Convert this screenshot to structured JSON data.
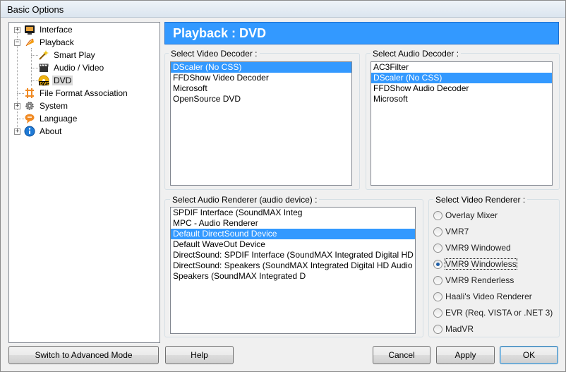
{
  "window": {
    "title": "Basic Options"
  },
  "tree": {
    "items": [
      {
        "label": "Interface",
        "icon": "monitor-icon"
      },
      {
        "label": "Playback",
        "icon": "play-icon"
      },
      {
        "label": "Smart Play",
        "icon": "magic-wand-icon"
      },
      {
        "label": "Audio / Video",
        "icon": "clapperboard-icon"
      },
      {
        "label": "DVD",
        "icon": "dvd-disc-icon"
      },
      {
        "label": "File Format Association",
        "icon": "file-association-icon"
      },
      {
        "label": "System",
        "icon": "gear-icon"
      },
      {
        "label": "Language",
        "icon": "speech-bubble-icon"
      },
      {
        "label": "About",
        "icon": "info-icon"
      }
    ],
    "selected": "DVD"
  },
  "header": {
    "title": "Playback : DVD"
  },
  "video_decoder": {
    "label": "Select Video Decoder :",
    "options": [
      "DScaler (No CSS)",
      "FFDShow Video Decoder",
      "Microsoft",
      "OpenSource DVD"
    ],
    "selected": "DScaler (No CSS)"
  },
  "audio_decoder": {
    "label": "Select Audio Decoder :",
    "options": [
      "AC3Filter",
      "DScaler (No CSS)",
      "FFDShow Audio Decoder",
      "Microsoft"
    ],
    "selected": "DScaler (No CSS)"
  },
  "audio_renderer": {
    "label": "Select Audio Renderer (audio device) :",
    "options": [
      "SPDIF Interface (SoundMAX Integ",
      "MPC - Audio Renderer",
      "Default DirectSound Device",
      "Default WaveOut Device",
      "DirectSound: SPDIF Interface (SoundMAX Integrated Digital HD",
      "DirectSound: Speakers (SoundMAX Integrated Digital HD Audio",
      "Speakers (SoundMAX Integrated D"
    ],
    "selected": "Default DirectSound Device"
  },
  "video_renderer": {
    "label": "Select Video Renderer :",
    "options": [
      "Overlay Mixer",
      "VMR7",
      "VMR9 Windowed",
      "VMR9 Windowless",
      "VMR9 Renderless",
      "Haali's Video Renderer",
      "EVR (Req. VISTA or .NET 3)",
      "MadVR"
    ],
    "selected": "VMR9 Windowless"
  },
  "buttons": {
    "advanced": "Switch to Advanced Mode",
    "help": "Help",
    "cancel": "Cancel",
    "apply": "Apply",
    "ok": "OK"
  },
  "colors": {
    "selection": "#3399ff",
    "header": "#3399ff"
  }
}
